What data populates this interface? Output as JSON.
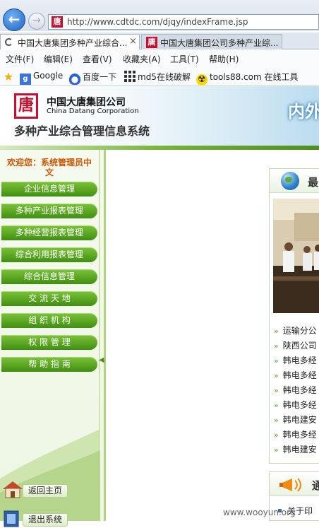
{
  "browser": {
    "url": "http://www.cdtdc.com/djqy/indexFrame.jsp",
    "tabs": [
      {
        "label": "中国大唐集团多种产业综合...",
        "close": "×"
      },
      {
        "label": "中国大唐集团公司多种产业综..."
      }
    ],
    "menu": [
      "文件(F)",
      "编辑(E)",
      "查看(V)",
      "收藏夹(A)",
      "工具(T)",
      "帮助(H)"
    ],
    "favorites": [
      "Google",
      "百度一下",
      "md5在线破解",
      "tools88.com 在线工具"
    ]
  },
  "header": {
    "logo_cn": "中国大唐集团公司",
    "logo_en": "China Datang Corporation",
    "system_title": "多种产业综合管理信息系统",
    "right_text": "内外"
  },
  "sidebar": {
    "welcome": "欢迎您：系统管理员中文",
    "nav": [
      "企业信息管理",
      "多种产业报表管理",
      "多种经营报表管理",
      "综合利用报表管理",
      "综合信息管理",
      "交 流 天 地",
      "组 织 机 构",
      "权 限 管 理",
      "帮 助 指 南"
    ],
    "links": {
      "home": "返回主页",
      "logout": "退出系统"
    }
  },
  "main": {
    "news_panel_title": "最",
    "news": [
      "运输分公",
      "陕西公司",
      "韩电多经",
      "韩电多经",
      "韩电多经",
      "韩电多经",
      "韩电建安",
      "韩电多经",
      "韩电建安"
    ],
    "notice_panel_title": "通",
    "notice_item": "关于印"
  },
  "watermark": "www.wooyun.org"
}
